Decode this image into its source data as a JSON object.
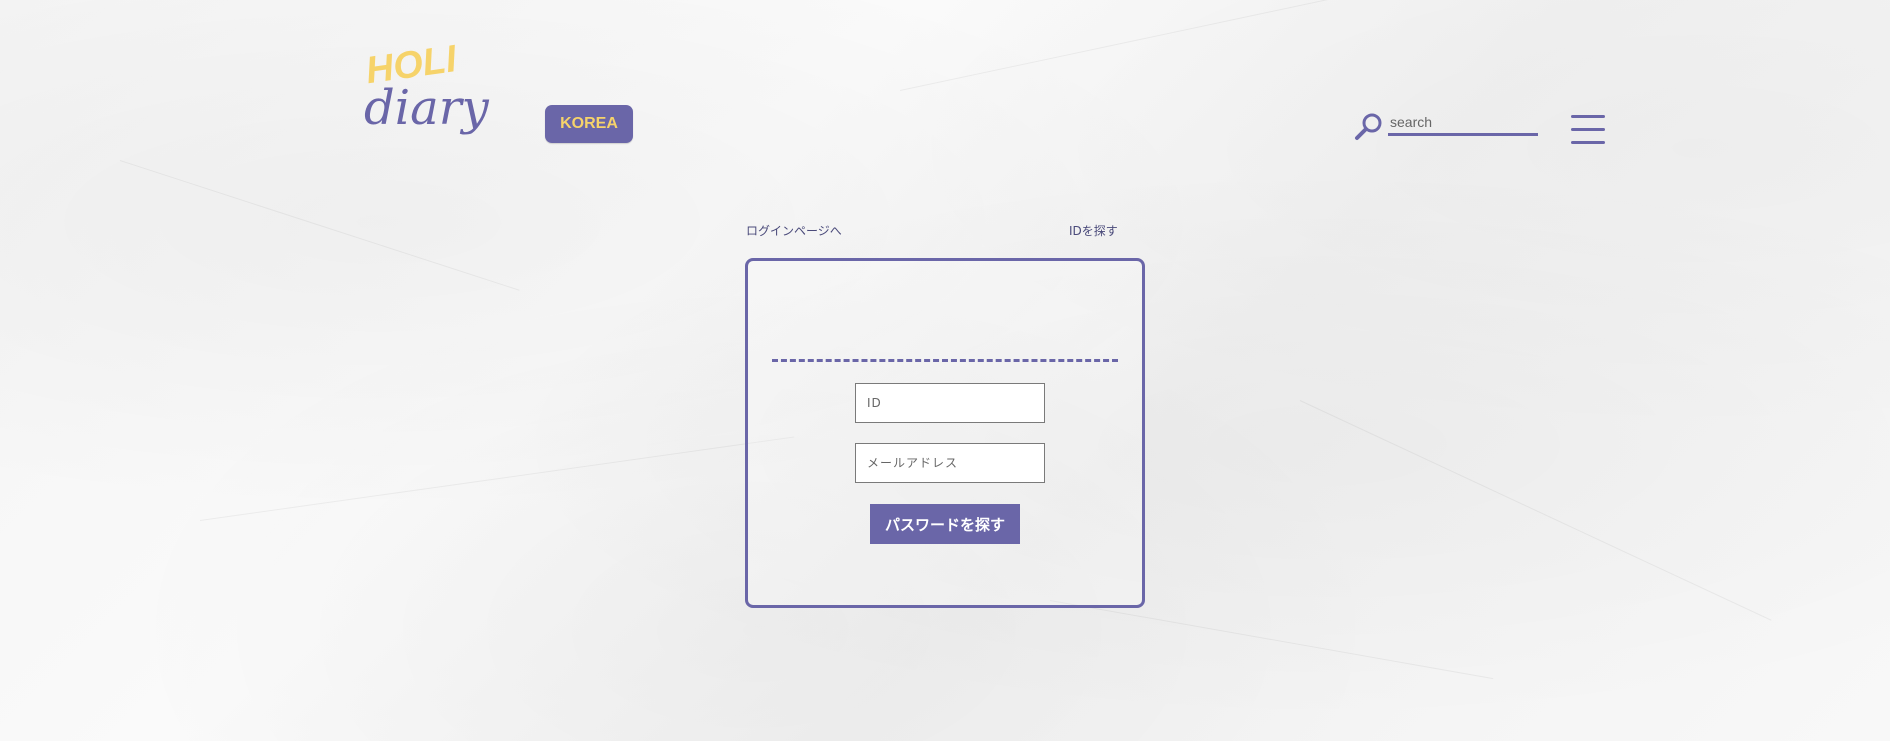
{
  "header": {
    "logo_top": "HOLI",
    "logo_bottom": "diary",
    "region_label": "KOREA",
    "search_placeholder": "search"
  },
  "nav": {
    "login_link": "ログインページへ",
    "find_id_link": "IDを探す"
  },
  "form": {
    "id_placeholder": "ID",
    "email_placeholder": "メールアドレス",
    "submit_label": "パスワードを探す"
  },
  "colors": {
    "primary": "#6a66a8",
    "accent": "#f6d36a"
  },
  "icons": {
    "search": "search-icon",
    "menu": "hamburger-menu-icon"
  }
}
